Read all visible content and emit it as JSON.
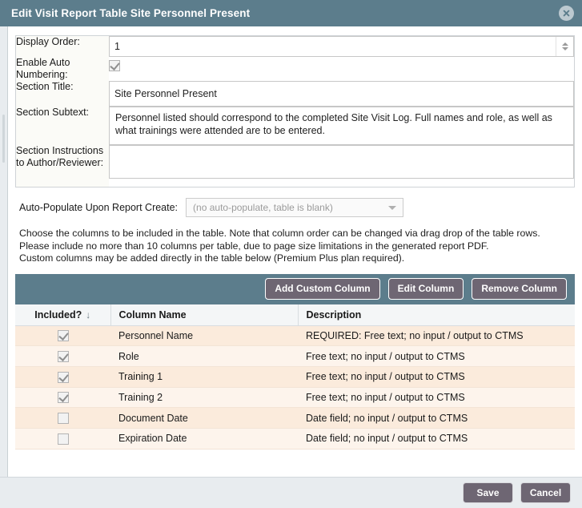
{
  "titlebar": {
    "title": "Edit Visit Report Table Site Personnel Present",
    "close_icon": "close-circle-icon"
  },
  "form": {
    "display_order": {
      "label": "Display Order:",
      "value": "1"
    },
    "enable_auto_numbering": {
      "label": "Enable Auto Numbering:",
      "checked": true
    },
    "section_title": {
      "label": "Section Title:",
      "value": "Site Personnel Present"
    },
    "section_subtext": {
      "label": "Section Subtext:",
      "value": "Personnel listed should correspond to the completed Site Visit Log. Full names and role, as well as what trainings were attended are to be entered."
    },
    "section_instructions": {
      "label": "Section Instructions to Author/Reviewer:",
      "value": ""
    }
  },
  "auto_populate": {
    "label": "Auto-Populate Upon Report Create:",
    "selected": "(no auto-populate, table is blank)"
  },
  "instructions": {
    "line1": "Choose the columns to be included in the table. Note that column order can be changed via drag drop of the table rows.",
    "line2": "Please include no more than 10 columns per table, due to page size limitations in the generated report PDF.",
    "line3": "Custom columns may be added directly in the table below (Premium Plus plan required)."
  },
  "toolbar": {
    "add_custom_column": "Add Custom Column",
    "edit_column": "Edit Column",
    "remove_column": "Remove Column"
  },
  "grid": {
    "headers": {
      "included": "Included?",
      "sort_indicator": "↓",
      "column_name": "Column Name",
      "description": "Description"
    },
    "rows": [
      {
        "included": true,
        "name": "Personnel Name",
        "description": "REQUIRED: Free text; no input / output to CTMS"
      },
      {
        "included": true,
        "name": "Role",
        "description": "Free text; no input / output to CTMS"
      },
      {
        "included": true,
        "name": "Training 1",
        "description": "Free text; no input / output to CTMS"
      },
      {
        "included": true,
        "name": "Training 2",
        "description": "Free text; no input / output to CTMS"
      },
      {
        "included": false,
        "name": "Document Date",
        "description": "Date field; no input / output to CTMS"
      },
      {
        "included": false,
        "name": "Expiration Date",
        "description": "Date field; no input / output to CTMS"
      }
    ]
  },
  "footer": {
    "save": "Save",
    "cancel": "Cancel"
  },
  "colors": {
    "titlebar": "#5c7d8c",
    "toolbar": "#5c7d8c",
    "button": "#6e6673",
    "row_odd": "#fbebdc",
    "row_even": "#fdf4ec",
    "footer": "#e8ecef"
  }
}
